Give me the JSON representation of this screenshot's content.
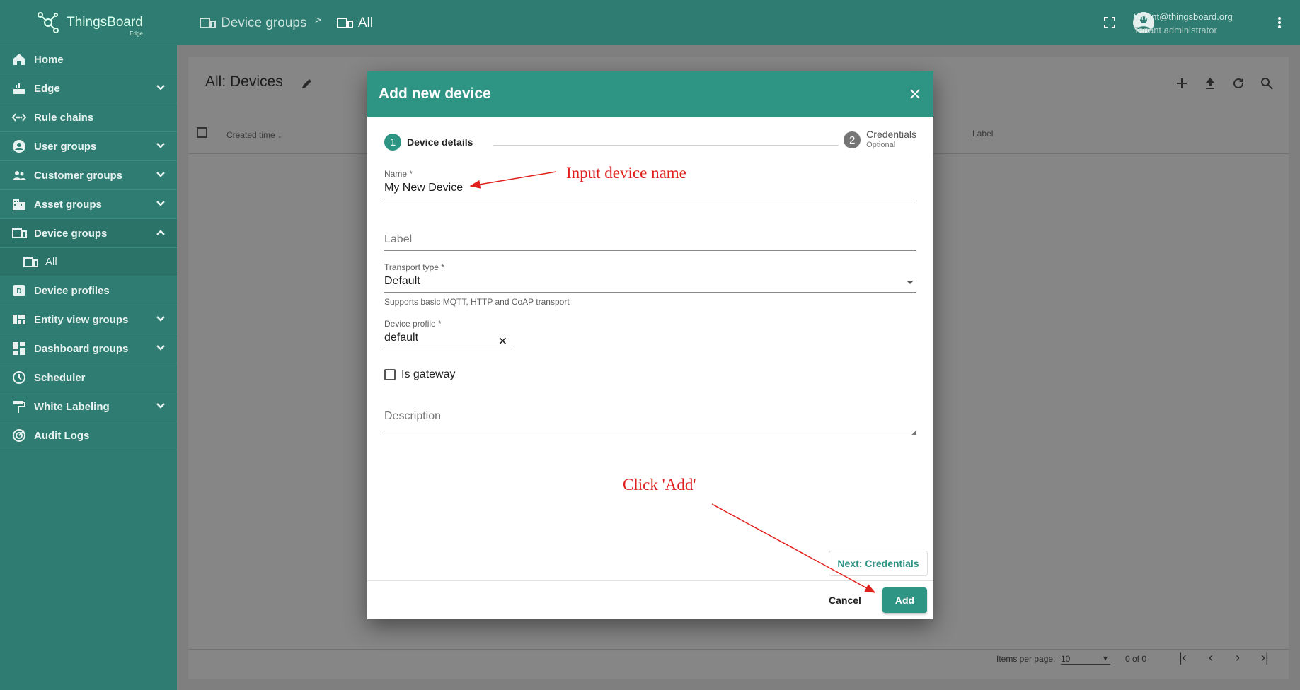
{
  "brand": {
    "name": "ThingsBoard",
    "sub": "Edge"
  },
  "sidebar": {
    "items": [
      {
        "label": "Home",
        "icon": "home-icon",
        "expandable": false
      },
      {
        "label": "Edge",
        "icon": "router-icon",
        "expandable": true
      },
      {
        "label": "Rule chains",
        "icon": "settings-ethernet-icon",
        "expandable": false
      },
      {
        "label": "User groups",
        "icon": "account-circle-icon",
        "expandable": true
      },
      {
        "label": "Customer groups",
        "icon": "supervisor-icon",
        "expandable": true
      },
      {
        "label": "Asset groups",
        "icon": "domain-icon",
        "expandable": true
      },
      {
        "label": "Device groups",
        "icon": "devices-other-icon",
        "expandable": true
      },
      {
        "label": "All",
        "icon": "devices-other-icon",
        "expandable": false
      },
      {
        "label": "Device profiles",
        "icon": "device-profile-icon",
        "expandable": false
      },
      {
        "label": "Entity view groups",
        "icon": "view-quilt-icon",
        "expandable": true
      },
      {
        "label": "Dashboard groups",
        "icon": "dashboard-icon",
        "expandable": true
      },
      {
        "label": "Scheduler",
        "icon": "schedule-icon",
        "expandable": false
      },
      {
        "label": "White Labeling",
        "icon": "format-paint-icon",
        "expandable": true
      },
      {
        "label": "Audit Logs",
        "icon": "track-changes-icon",
        "expandable": false
      }
    ]
  },
  "topbar": {
    "breadcrumb_1": "Device groups",
    "separator": ">",
    "breadcrumb_2": "All",
    "user_email": "tenant@thingsboard.org",
    "user_role": "Tenant administrator"
  },
  "main": {
    "title": "All: Devices",
    "col_created": "Created time",
    "col_label": "Label",
    "items_per_page_label": "Items per page:",
    "items_per_page_value": "10",
    "range": "0 of 0"
  },
  "dialog": {
    "title": "Add new device",
    "step1_num": "1",
    "step1_label": "Device details",
    "step2_num": "2",
    "step2_label": "Credentials",
    "step2_sub": "Optional",
    "name_label": "Name *",
    "name_value": "My New Device",
    "label_placeholder": "Label",
    "transport_label": "Transport type *",
    "transport_value": "Default",
    "transport_hint": "Supports basic MQTT, HTTP and CoAP transport",
    "profile_label": "Device profile *",
    "profile_value": "default",
    "gateway_label": "Is gateway",
    "description_placeholder": "Description",
    "next_label": "Next: Credentials",
    "cancel_label": "Cancel",
    "add_label": "Add"
  },
  "annotations": {
    "input_name": "Input device name",
    "click_add": "Click 'Add'"
  },
  "colors": {
    "primary": "#2e9484",
    "sidebar": "#2f7d72",
    "annotation": "#e0201c"
  }
}
